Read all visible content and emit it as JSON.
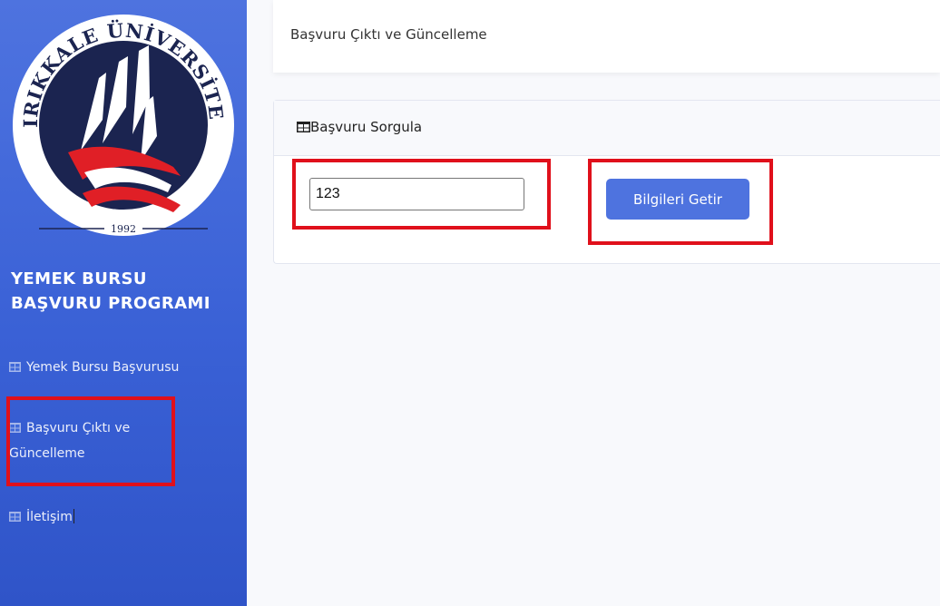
{
  "sidebar": {
    "logo": {
      "text_top": "KIRIKKALE ÜNİVERSİTESİ",
      "year": "1992",
      "colors": {
        "navy": "#1b2450",
        "red": "#e01f26",
        "white": "#ffffff"
      }
    },
    "brand_line1": "YEMEK BURSU",
    "brand_line2": "BAŞVURU PROGRAMI",
    "items": [
      {
        "label": "Yemek Bursu Başvurusu",
        "icon": "table-icon"
      },
      {
        "label_line1": "Başvuru Çıktı ve",
        "label_line2": "Güncelleme",
        "icon": "table-icon"
      },
      {
        "label": "İletişim",
        "icon": "table-icon"
      }
    ]
  },
  "topbar": {
    "title": "Başvuru Çıktı ve Güncelleme"
  },
  "card": {
    "title": "Başvuru Sorgula",
    "icon": "table-icon",
    "input_value": "123",
    "button_label": "Bilgileri Getir"
  },
  "colors": {
    "primary": "#4e73df",
    "highlight": "#e0101b",
    "background": "#f8f9fc"
  }
}
